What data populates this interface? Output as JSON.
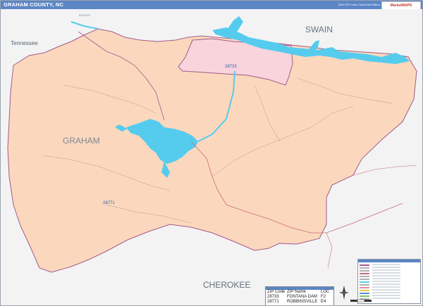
{
  "map": {
    "title": "GRAHAM COUNTY, NC",
    "edition": "2020 ZIP Code ColorCast Edition",
    "publisher_logo": "MarketMAPS",
    "colors": {
      "county_fill": "#fbd8bd",
      "zip_28733_fill": "#f9d4dd",
      "water": "#55ccee",
      "outside": "#f3f3f4",
      "boundary": "#a35a8a",
      "title_bar": "#5b86c6"
    },
    "region_labels": {
      "swain": "SWAIN",
      "tennessee": "Tennessee",
      "graham": "GRAHAM",
      "cherokee": "CHEROKEE",
      "blount": "BLOUNT"
    },
    "zip_labels": {
      "zip_28733": "28733",
      "zip_28771": "28771"
    }
  },
  "zip_table": {
    "headers": [
      "ZIP Code",
      "ZIP Name",
      "LOC"
    ],
    "rows": [
      {
        "zip": "28733",
        "name": "FONTANA DAM",
        "loc": "F2"
      },
      {
        "zip": "28771",
        "name": "ROBBINSVILLE",
        "loc": "E4"
      }
    ]
  }
}
